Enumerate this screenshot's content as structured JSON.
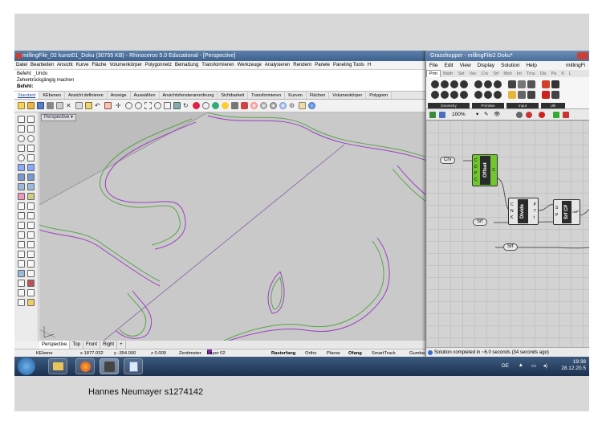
{
  "rhino": {
    "title": "millingFile_02 kunst01_Doku (30755 KB) - Rhinoceros 5.0 Educational - [Perspective]",
    "menu": [
      "Datei",
      "Bearbeiten",
      "Ansicht",
      "Kurve",
      "Fläche",
      "Volumenkörper",
      "Polygonnetz",
      "Bemaßung",
      "Transformieren",
      "Werkzeuge",
      "Analysieren",
      "Rendern",
      "Panele",
      "Paneling Tools",
      "H"
    ],
    "history": [
      "Befehl: _Undo",
      "Zehentrückgängig machen"
    ],
    "prompt": "Befehl:",
    "tabs": [
      "Standard",
      "KEbenen",
      "Ansicht definieren",
      "Anzeige",
      "Auswählen",
      "Ansichtsfensteranordnung",
      "Sichtbarkeit",
      "Transformieren",
      "Kurven",
      "Flächen",
      "Volumenkörper",
      "Polygonn"
    ],
    "active_tab": 0,
    "viewport_label": "Perspective",
    "view_tabs": [
      "Perspective",
      "Top",
      "Front",
      "Right",
      "+"
    ],
    "status": {
      "layer_label": "KEbene",
      "x": "x 1877.032",
      "y": "y -354.000",
      "z": "z 0.000",
      "units": "Zentimeter",
      "layer": "Layer 02",
      "raster": "Rasterfang",
      "ortho": "Ortho",
      "planar": "Planar",
      "ofang": "Ofang",
      "smart": "SmartTrack",
      "gumball": "Gumba"
    }
  },
  "grasshopper": {
    "title": "Grasshopper - millingFile2 Doku*",
    "menu": [
      "File",
      "Edit",
      "View",
      "Display",
      "Solution",
      "Help"
    ],
    "filename": "millingFi",
    "tabs": [
      "Prm",
      "Math",
      "Set",
      "Vec",
      "Crv",
      "Srf",
      "Msh",
      "Int",
      "Trns",
      "Dis",
      "Pa",
      "K",
      "L"
    ],
    "categories": [
      "Geometry",
      "Primitive",
      "Input",
      "Util"
    ],
    "zoom": "100%",
    "status": "Solution completed in ~6.0 seconds (34 seconds ago)",
    "nodes": {
      "crv_param": "Crv",
      "offset": {
        "title": "Offset",
        "inputs": [
          "C",
          "D",
          "P",
          "C"
        ],
        "outputs": [
          "C"
        ]
      },
      "divide": {
        "title": "Divide",
        "inputs": [
          "C",
          "N",
          "K"
        ],
        "outputs": [
          "P",
          "T",
          "t"
        ]
      },
      "srfcp": {
        "title": "Srf CP",
        "inputs": [
          "S",
          "P"
        ],
        "outputs": [
          "uvP"
        ]
      },
      "srf1": "Srf",
      "srf2": "Srf"
    }
  },
  "taskbar": {
    "lang": "DE",
    "time": "19:38",
    "date": "28.12.20.5"
  },
  "caption": "Hannes Neumayer s1274142",
  "colors": {
    "offset_node": "#70c530",
    "curve_green": "#5aa34a",
    "curve_purple": "#9a3fc0",
    "viewport": "#bdbdbd"
  }
}
